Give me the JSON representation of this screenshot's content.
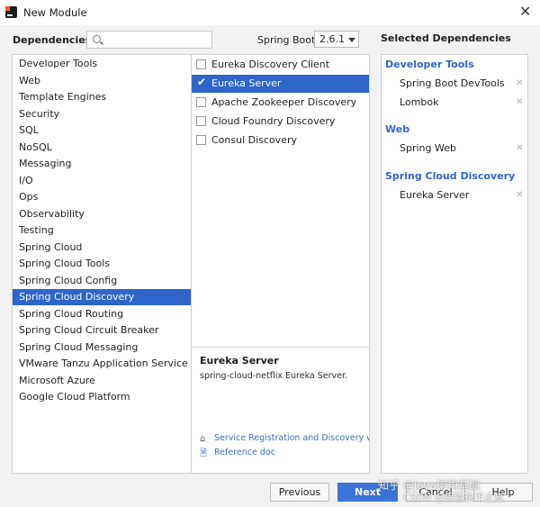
{
  "window": {
    "title": "New Module"
  },
  "header": {
    "dependencies_label": "Dependencies",
    "search": {
      "value": "",
      "placeholder": ""
    },
    "spring_boot_label": "Spring Boot",
    "spring_boot_version": "2.6.1",
    "selected_dependencies_label": "Selected Dependencies"
  },
  "categories": [
    "Developer Tools",
    "Web",
    "Template Engines",
    "Security",
    "SQL",
    "NoSQL",
    "Messaging",
    "I/O",
    "Ops",
    "Observability",
    "Testing",
    "Spring Cloud",
    "Spring Cloud Tools",
    "Spring Cloud Config",
    "Spring Cloud Discovery",
    "Spring Cloud Routing",
    "Spring Cloud Circuit Breaker",
    "Spring Cloud Messaging",
    "VMware Tanzu Application Service",
    "Microsoft Azure",
    "Google Cloud Platform"
  ],
  "selected_category": "Spring Cloud Discovery",
  "dependencies": [
    {
      "name": "Eureka Discovery Client",
      "checked": false
    },
    {
      "name": "Eureka Server",
      "checked": true
    },
    {
      "name": "Apache Zookeeper Discovery",
      "checked": false
    },
    {
      "name": "Cloud Foundry Discovery",
      "checked": false
    },
    {
      "name": "Consul Discovery",
      "checked": false
    }
  ],
  "description": {
    "title": "Eureka Server",
    "text": "spring-cloud-netflix Eureka Server.",
    "links": [
      {
        "label": "Service Registration and Discovery with Eureka and Spring Cloud",
        "icon": "home-icon"
      },
      {
        "label": "Reference doc",
        "icon": "doc-icon"
      }
    ]
  },
  "selected": [
    {
      "group": "Developer Tools",
      "items": [
        "Spring Boot DevTools",
        "Lombok"
      ]
    },
    {
      "group": "Web",
      "items": [
        "Spring Web"
      ]
    },
    {
      "group": "Spring Cloud Discovery",
      "items": [
        "Eureka Server"
      ]
    }
  ],
  "buttons": {
    "previous": "Previous",
    "next": "Next",
    "cancel": "Cancel",
    "help": "Help"
  },
  "watermark": {
    "line1": "知乎 @java架构基础",
    "line2": "CSDN @探索永不止息"
  },
  "colors": {
    "accent": "#2f65ca",
    "primary_button": "#3b73d6"
  }
}
